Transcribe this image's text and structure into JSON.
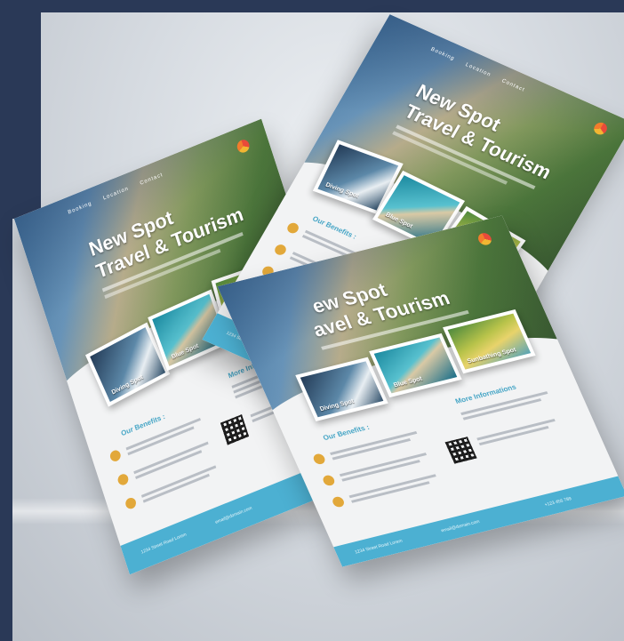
{
  "scene": {
    "background_color": "#cfd4da",
    "frame_color": "#2a3957",
    "accent_blue": "#4cb0d2",
    "accent_gold": "#e2a83a"
  },
  "flyer": {
    "title_line1": "New Spot",
    "title_line2": "Travel & Tourism",
    "title_line2_partial": "avel & Tourism",
    "title_line1_partial": "ew Spot",
    "photos": [
      {
        "caption": "Diving Spot"
      },
      {
        "caption": "Blue Spot"
      },
      {
        "caption": "Sunbathing Spot"
      }
    ],
    "benefits_heading": "Our Benefits :",
    "info_heading": "More Informations"
  }
}
